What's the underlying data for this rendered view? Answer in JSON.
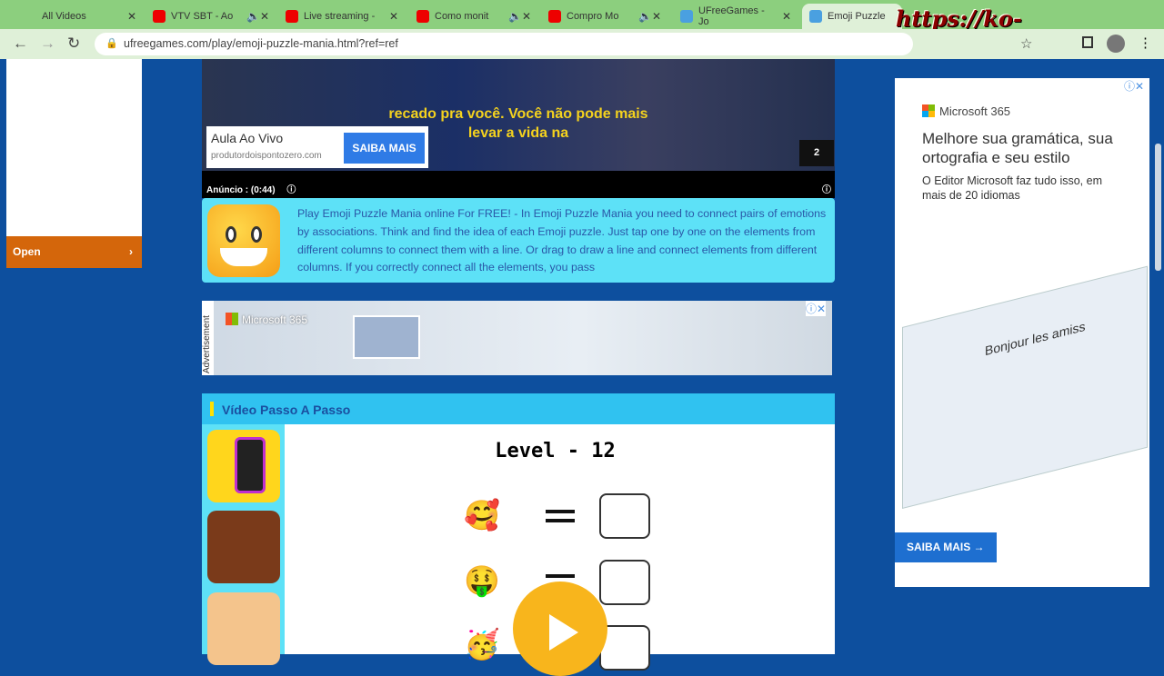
{
  "browser": {
    "tabs": [
      {
        "title": "All Videos",
        "icon": "none"
      },
      {
        "title": "VTV SBT - Ao",
        "icon": "youtube"
      },
      {
        "title": "Live streaming -",
        "icon": "youtube"
      },
      {
        "title": "Como monit",
        "icon": "youtube"
      },
      {
        "title": "Compro Mo",
        "icon": "youtube"
      },
      {
        "title": "UFreeGames - Jo",
        "icon": "ufreegames"
      },
      {
        "title": "Emoji Puzzle",
        "icon": "ufreegames"
      }
    ],
    "url": "ufreegames.com/play/emoji-puzzle-mania.html?ref=ref",
    "watermark": "https://ko-fi.com/gokagen"
  },
  "left_ad": {
    "open": "Open"
  },
  "video_ad": {
    "caption": "recado pra você. Você não pode mais levar a vida na",
    "card_title": "Aula Ao Vivo",
    "card_domain": "produtordoispontozero.com",
    "card_button": "SAIBA MAIS",
    "counter": "2",
    "timer": "Anúncio : (0:44)"
  },
  "description": "Play Emoji Puzzle Mania online For FREE! - In Emoji Puzzle Mania you need to connect pairs of emotions by associations. Think and find the idea of each Emoji puzzle. Just tap one by one on the elements from different columns to connect them with a line. Or drag to draw a line and connect elements from different columns. If you correctly connect all the elements, you pass",
  "banner_ad": {
    "label": "Advertisement",
    "brand": "Microsoft 365"
  },
  "video_section": {
    "title": "Vídeo Passo A Passo",
    "level": "Level - 12",
    "emojis": [
      "🥰",
      "🤑",
      "🥳"
    ]
  },
  "right_ad": {
    "brand": "Microsoft 365",
    "headline": "Melhore sua gramática, sua ortografia e seu estilo",
    "body": "O Editor Microsoft faz tudo isso, em mais de 20 idiomas",
    "image_text": "Bonjour les amiss",
    "button": "SAIBA MAIS →"
  }
}
